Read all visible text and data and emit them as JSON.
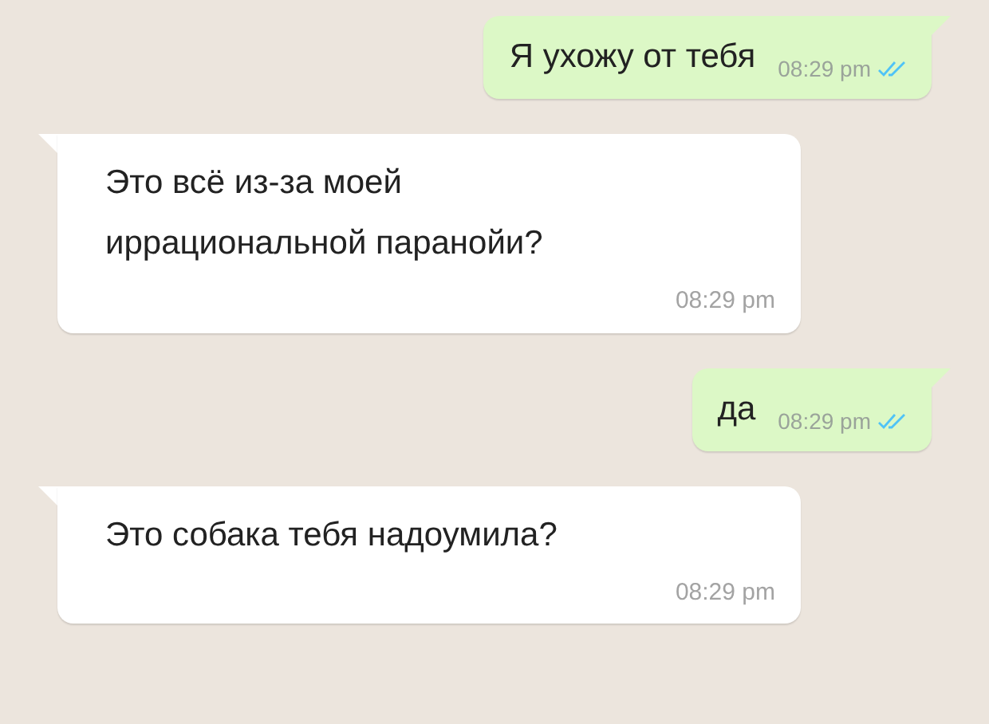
{
  "messages": [
    {
      "kind": "outgoing",
      "text": "Я ухожу от тебя",
      "time": "08:29 pm",
      "read": true
    },
    {
      "kind": "incoming",
      "text": "Это всё из-за моей иррациональной паранойи?",
      "time": "08:29 pm"
    },
    {
      "kind": "outgoing",
      "text": "да",
      "time": "08:29 pm",
      "read": true
    },
    {
      "kind": "incoming",
      "text": "Это собака тебя надоумила?",
      "time": "08:29 pm"
    }
  ]
}
